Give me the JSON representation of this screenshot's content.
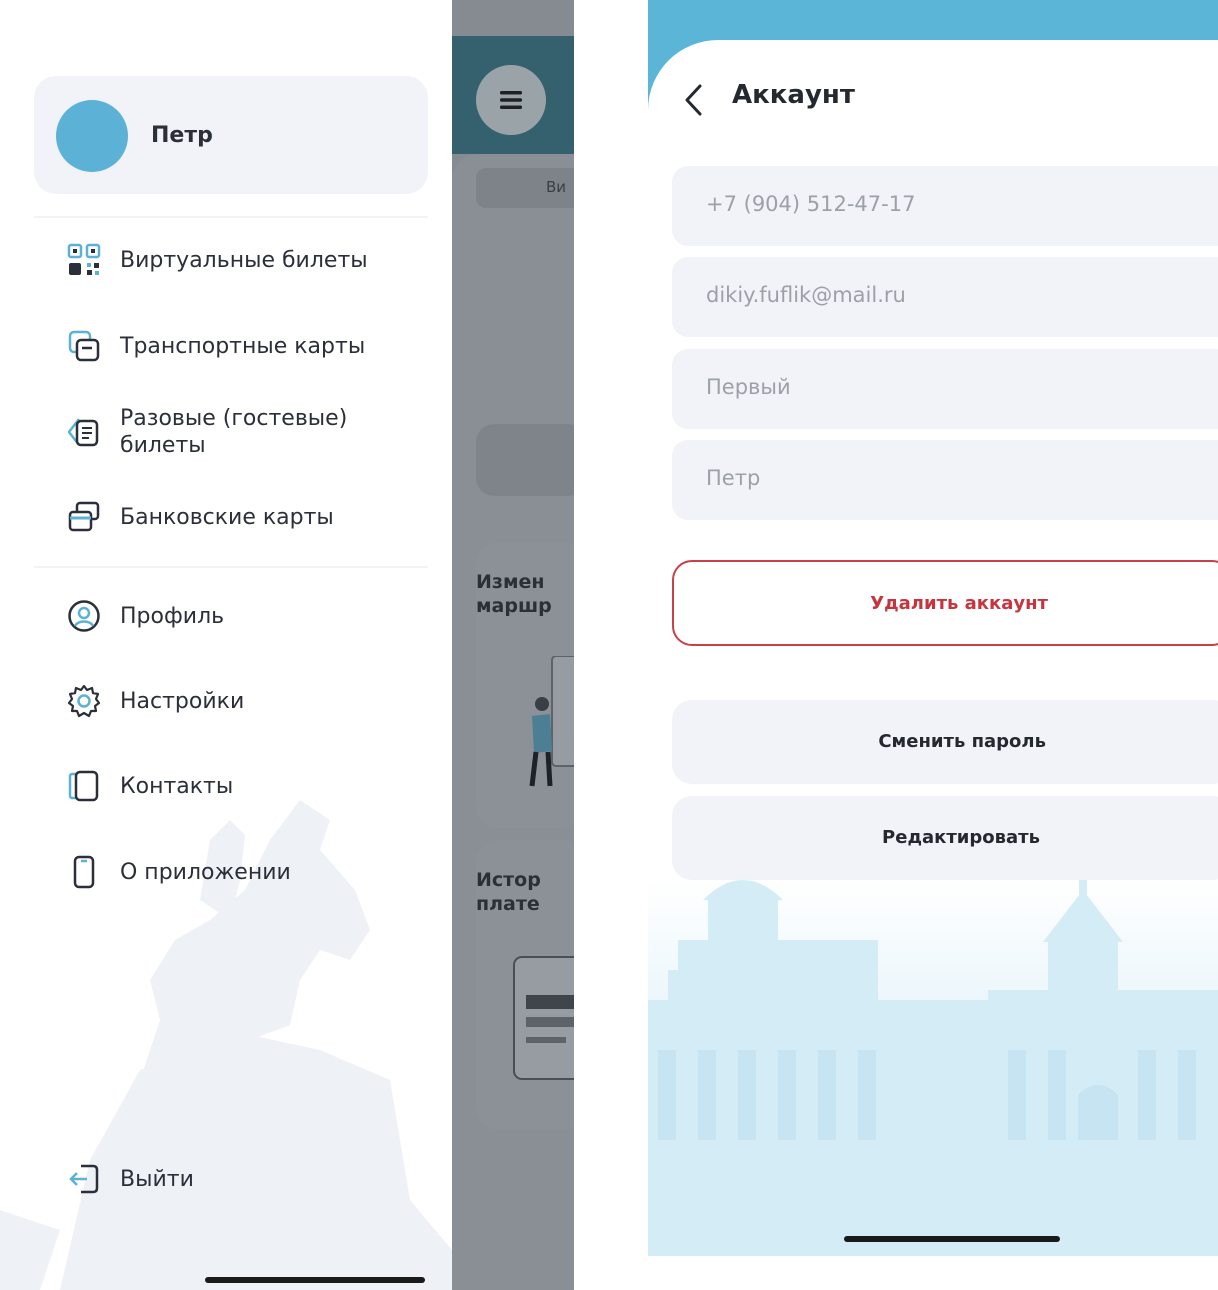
{
  "drawer": {
    "user_name": "Петр",
    "avatar_color": "#5bb2d6",
    "sections": [
      [
        {
          "label": "Виртуальные билеты",
          "icon": "qr-code-icon"
        },
        {
          "label": "Транспортные карты",
          "icon": "transport-card-icon"
        },
        {
          "label": "Разовые (гостевые)\nбилеты",
          "icon": "guest-ticket-icon"
        },
        {
          "label": "Банковские карты",
          "icon": "bank-cards-icon"
        }
      ],
      [
        {
          "label": "Профиль",
          "icon": "profile-icon"
        },
        {
          "label": "Настройки",
          "icon": "settings-icon"
        },
        {
          "label": "Контакты",
          "icon": "contacts-icon"
        },
        {
          "label": "О приложении",
          "icon": "phone-icon"
        }
      ]
    ],
    "logout_label": "Выйти",
    "accent_color": "#5bb2d6"
  },
  "background_screen": {
    "chip_text": "Ви",
    "card1_title": "Измен\nмаршр",
    "card2_title": "Истор\nплате"
  },
  "account": {
    "title": "Аккаунт",
    "phone": "+7 (904) 512-47-17",
    "email": "dikiy.fuflik@mail.ru",
    "last_name": "Первый",
    "first_name": "Петр",
    "delete_label": "Удалить аккаунт",
    "change_password_label": "Сменить пароль",
    "edit_label": "Редактировать",
    "header_color": "#5ab5d7",
    "danger_color": "#c8343e"
  }
}
